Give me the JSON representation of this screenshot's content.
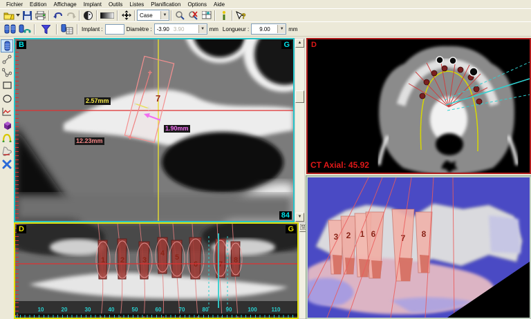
{
  "menu": {
    "items": [
      "Fichier",
      "Edition",
      "Affichage",
      "Implant",
      "Outils",
      "Listes",
      "Planification",
      "Options",
      "Aide"
    ]
  },
  "toolbar1": {
    "case_select_value": "Case",
    "icons": [
      "open-folder-icon",
      "save-icon",
      "print-icon",
      "undo-icon",
      "redo-icon",
      "patient-icon",
      "contrast-icon",
      "pan-icon",
      "zoom-icon",
      "zoom-reset-icon",
      "layout-icon",
      "info-icon",
      "context-help-icon"
    ]
  },
  "toolbar2": {
    "icons": [
      "implant-library-icon",
      "implant-edit-icon",
      "filter-icon",
      "implant-list-icon"
    ],
    "implant_label": "Implant :",
    "implant_value": "",
    "diameter_label": "Diamètre :",
    "diameter_value": "-3.90",
    "diameter_ghost": "3.90",
    "mm_1": "mm",
    "length_label": "Longueur :",
    "length_value": "9.00",
    "mm_2": "mm"
  },
  "left_toolbar": {
    "icons": [
      "implant-icon",
      "measure-distance-icon",
      "measure-angle-icon",
      "rectangle-icon",
      "ellipse-icon",
      "profile-curve-icon",
      "cube-3d-icon",
      "panoramic-curve-icon",
      "chair-icon",
      "tools-icon"
    ]
  },
  "cross_section": {
    "label_left": "B",
    "label_right": "G",
    "slice_number": "84",
    "implant_number": "7",
    "measurements": {
      "m1": "2.57mm",
      "m2": "1.90mm",
      "m3": "12.23mm"
    }
  },
  "axial": {
    "label": "D",
    "status": "CT Axial: 45.92"
  },
  "panoramic": {
    "label_left": "D",
    "label_right": "G",
    "implants": [
      "1",
      "2",
      "3",
      "4",
      "5",
      "6",
      "7",
      "8"
    ],
    "ruler": [
      "10",
      "20",
      "30",
      "40",
      "50",
      "60",
      "70",
      "80",
      "90",
      "100",
      "110"
    ]
  },
  "view3d": {
    "implant_labels": [
      "3",
      "2",
      "1",
      "6",
      "7",
      "8"
    ]
  },
  "colors": {
    "ui_beige": "#ece9d8",
    "cross_border": "#27c5c9",
    "axial_border": "#b01b1b",
    "pano_border": "#e3e00a",
    "cyan_text": "#00e0e8",
    "yellow_text": "#e8e000",
    "red_overlay": "#e03030",
    "measure_yellow": "#f5e949",
    "measure_magenta": "#f26ef2",
    "measure_salmon": "#f28585",
    "implant_red": "#9c3a34",
    "bg_3d_blue": "#4747c2"
  }
}
